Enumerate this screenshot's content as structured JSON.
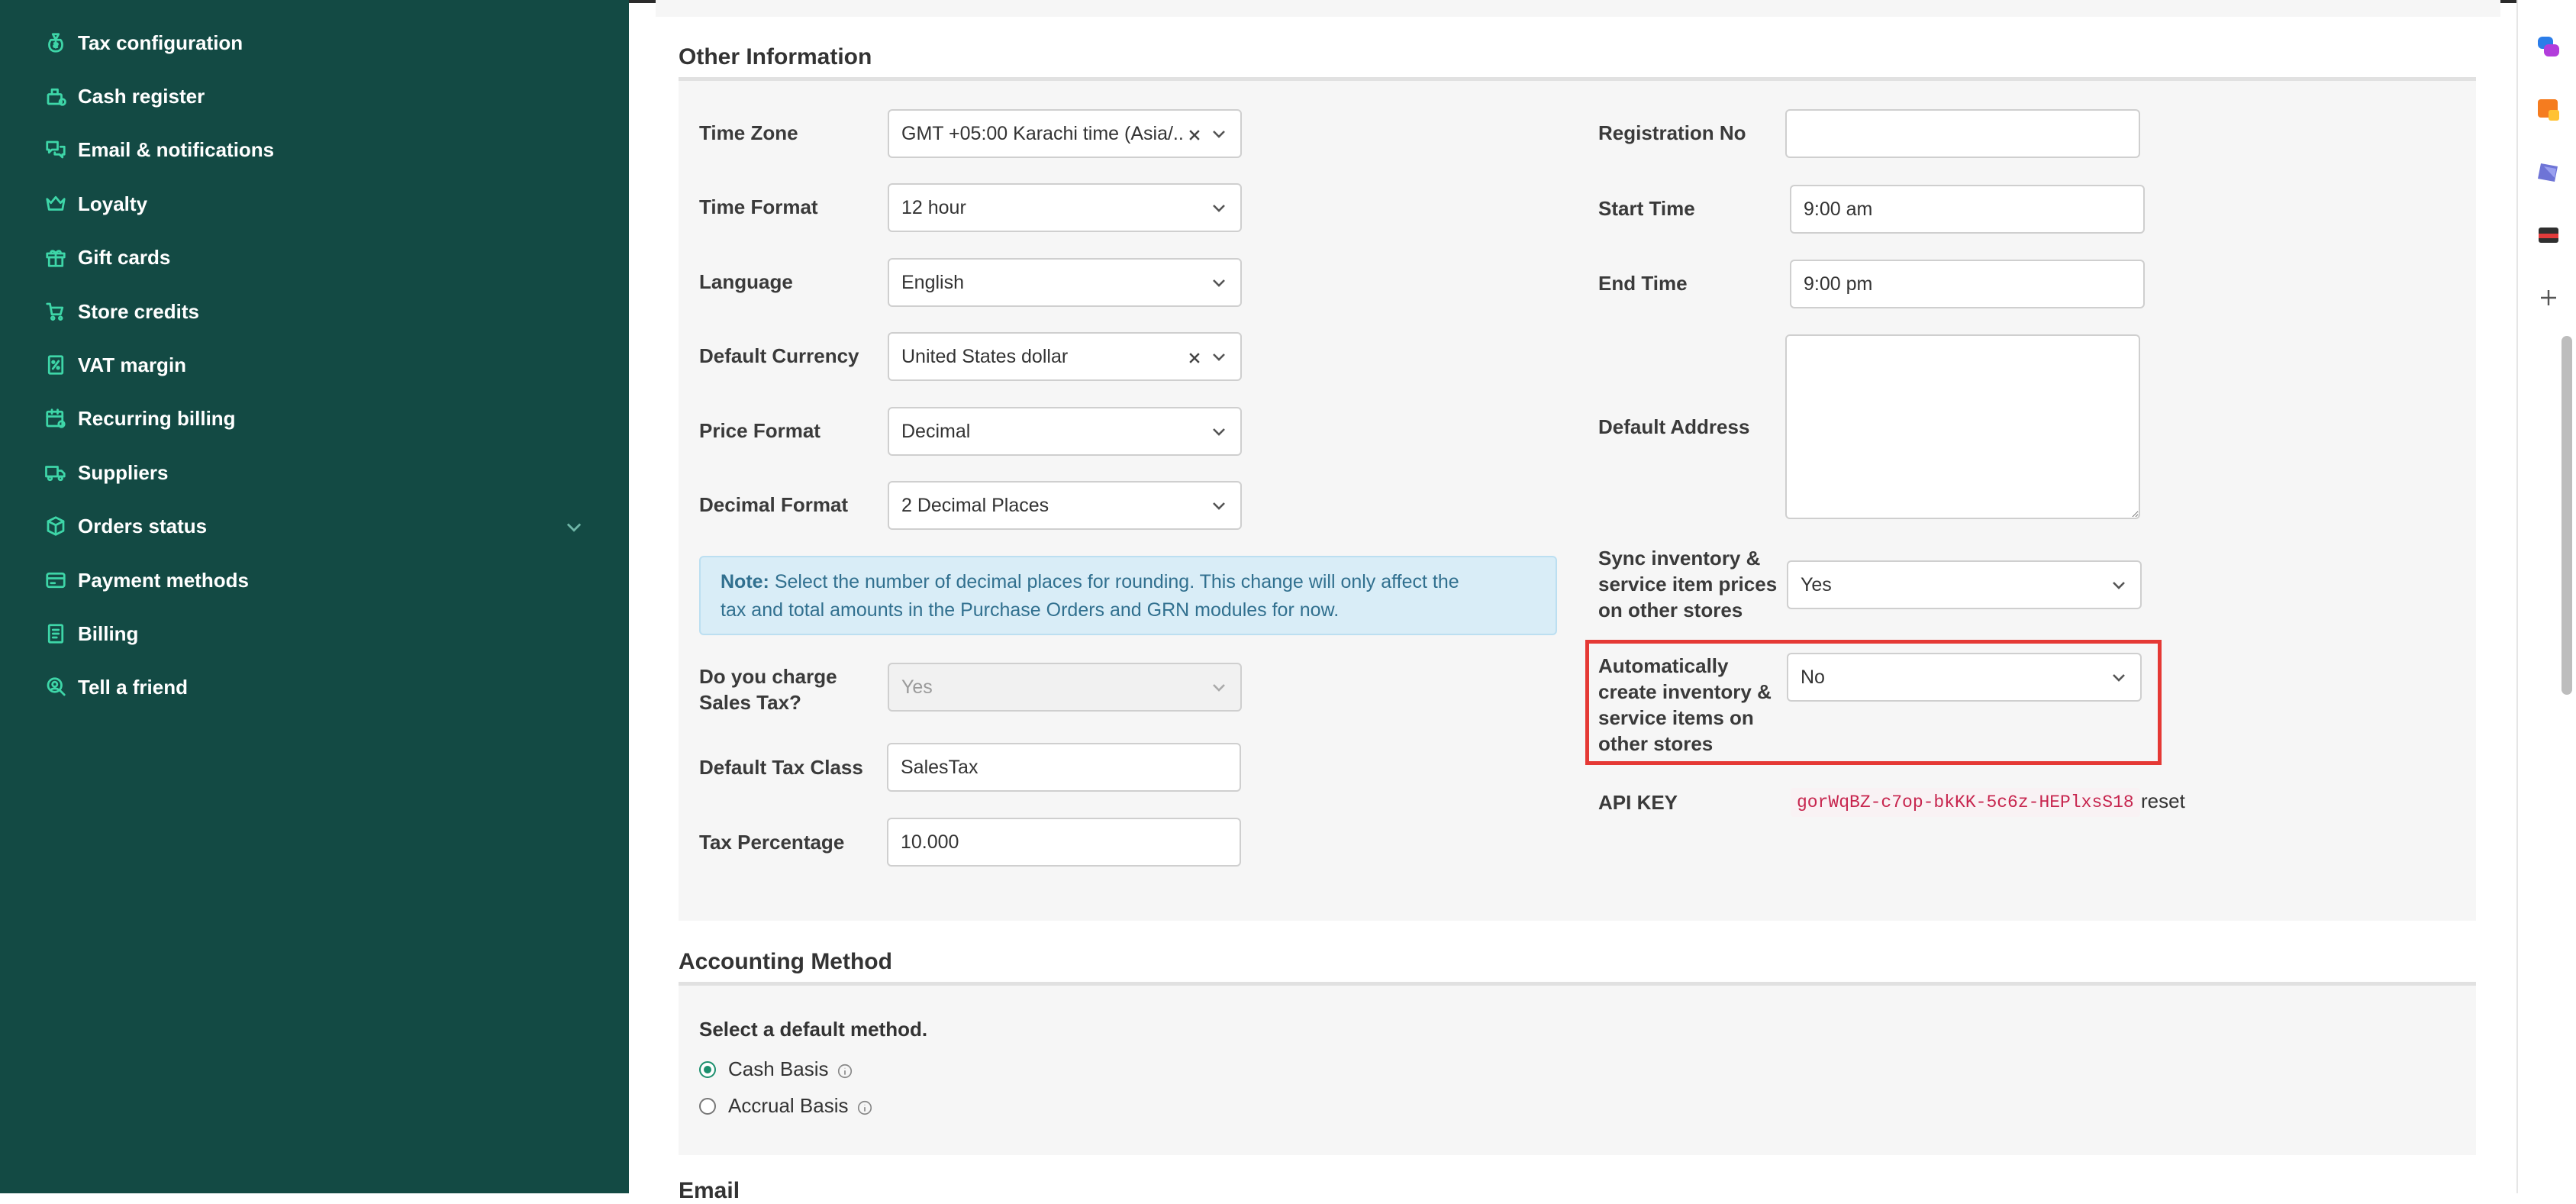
{
  "sidebar": {
    "items": [
      {
        "label": "Tax configuration",
        "icon": "money-bag-icon"
      },
      {
        "label": "Cash register",
        "icon": "cash-register-icon"
      },
      {
        "label": "Email & notifications",
        "icon": "chat-bubbles-icon"
      },
      {
        "label": "Loyalty",
        "icon": "crown-icon"
      },
      {
        "label": "Gift cards",
        "icon": "gift-icon"
      },
      {
        "label": "Store credits",
        "icon": "cart-credit-icon"
      },
      {
        "label": "VAT margin",
        "icon": "percent-receipt-icon"
      },
      {
        "label": "Recurring billing",
        "icon": "calendar-repeat-icon"
      },
      {
        "label": "Suppliers",
        "icon": "truck-icon"
      },
      {
        "label": "Orders status",
        "icon": "box-icon"
      },
      {
        "label": "Payment methods",
        "icon": "card-icon"
      },
      {
        "label": "Billing",
        "icon": "receipt-icon"
      },
      {
        "label": "Tell a friend",
        "icon": "user-search-icon"
      }
    ],
    "accent": "#3ed6a8",
    "background": "#134a44"
  },
  "other_info": {
    "title": "Other Information",
    "time_zone": {
      "label": "Time Zone",
      "value": "GMT +05:00 Karachi time (Asia/..."
    },
    "time_format": {
      "label": "Time Format",
      "value": "12 hour"
    },
    "language": {
      "label": "Language",
      "value": "English"
    },
    "default_currency": {
      "label": "Default Currency",
      "value": "United States dollar"
    },
    "price_format": {
      "label": "Price Format",
      "value": "Decimal"
    },
    "decimal_format": {
      "label": "Decimal Format",
      "value": "2 Decimal Places"
    },
    "note": {
      "prefix": "Note:",
      "line1": " Select the number of decimal places for rounding. This change will only affect the",
      "line2": "tax and total amounts in the Purchase Orders and GRN modules for now."
    },
    "charge_sales_tax": {
      "label_line1": "Do you charge",
      "label_line2": "Sales Tax?",
      "value": "Yes"
    },
    "default_tax_class": {
      "label": "Default Tax Class",
      "value": "SalesTax"
    },
    "tax_percentage": {
      "label": "Tax Percentage",
      "value": "10.000"
    },
    "registration_no": {
      "label": "Registration No",
      "value": ""
    },
    "start_time": {
      "label": "Start Time",
      "value": "9:00 am"
    },
    "end_time": {
      "label": "End Time",
      "value": "9:00 pm"
    },
    "default_address": {
      "label": "Default Address",
      "value": ""
    },
    "sync_inventory": {
      "label_line1": "Sync inventory &",
      "label_line2": "service item prices",
      "label_line3": "on other stores",
      "value": "Yes"
    },
    "auto_create": {
      "label_line1": "Automatically",
      "label_line2": "create inventory &",
      "label_line3": "service items on",
      "label_line4": "other stores",
      "value": "No"
    },
    "api_key": {
      "label": "API KEY",
      "value": "gorWqBZ-c7op-bkKK-5c6z-HEPlxsS18",
      "reset_label": "reset"
    }
  },
  "accounting": {
    "title": "Accounting Method",
    "subtitle": "Select a default method.",
    "options": [
      {
        "label": "Cash Basis",
        "checked": true
      },
      {
        "label": "Accrual Basis",
        "checked": false
      }
    ]
  },
  "next_section": {
    "title": "Email"
  },
  "colors": {
    "highlight": "#e53935",
    "radio_accent": "#1b8f6d",
    "note_bg": "#d9edf7"
  }
}
